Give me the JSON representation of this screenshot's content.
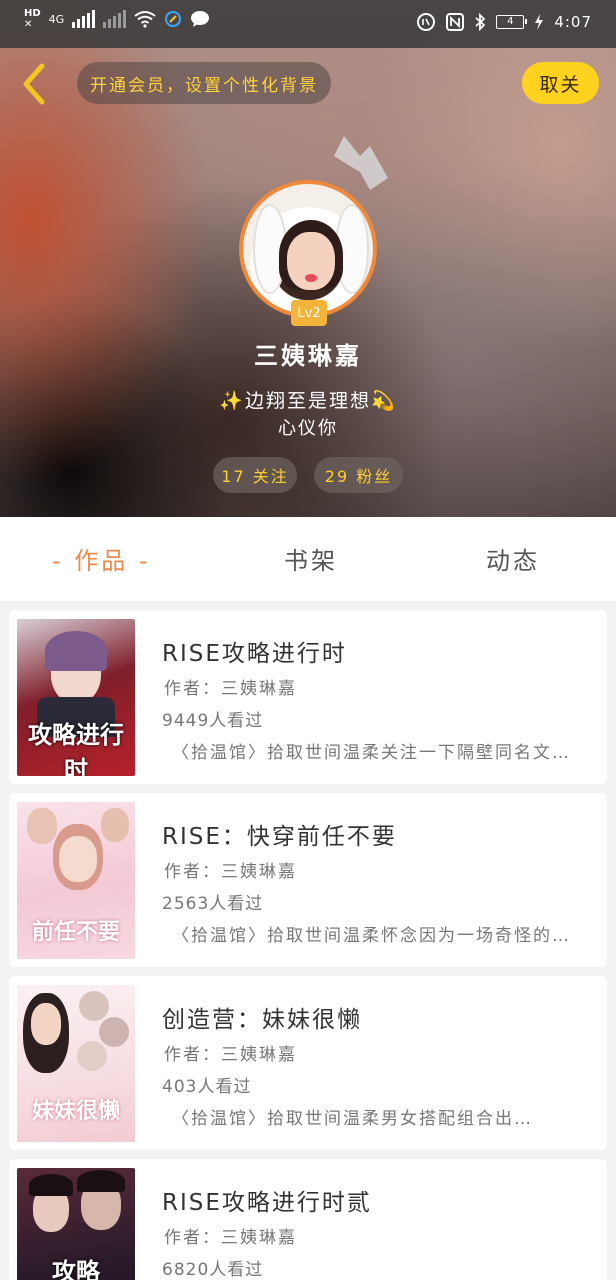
{
  "status_bar": {
    "hd": "HD",
    "network": "4G",
    "battery": "4",
    "time": "4:07"
  },
  "header": {
    "back_icon": "chevron-left-icon",
    "vip_prompt": "开通会员，设置个性化背景",
    "unfollow_label": "取关",
    "level": "Lv2",
    "username": "三姨琳嘉",
    "signature_line1": "✨边翔至是理想💫",
    "signature_line2": "心仪你",
    "follow_count": "17 关注",
    "fans_count": "29 粉丝"
  },
  "tabs": [
    {
      "label": "- 作品 -",
      "active": true
    },
    {
      "label": "书架",
      "active": false
    },
    {
      "label": "动态",
      "active": false
    }
  ],
  "books": [
    {
      "title": "RISE攻略进行时",
      "author": "作者：三姨琳嘉",
      "views": "9449人看过",
      "intro": "〈拾温馆〉拾取世间温柔关注一下隔壁同名文…",
      "cover_text": "攻略进行时",
      "cover_color": "#b7202a"
    },
    {
      "title": "RISE：快穿前任不要",
      "author": "作者：三姨琳嘉",
      "views": "2563人看过",
      "intro": "〈拾温馆〉拾取世间温柔怀念因为一场奇怪的…",
      "cover_text": "前任不要",
      "cover_color": "#f3c6d2"
    },
    {
      "title": "创造营：妹妹很懒",
      "author": "作者：三姨琳嘉",
      "views": "403人看过",
      "intro": "〈拾温馆〉拾取世间温柔男女搭配组合出…",
      "cover_text": "妹妹很懒",
      "cover_color": "#f6dde2"
    },
    {
      "title": "RISE攻略进行时贰",
      "author": "作者：三姨琳嘉",
      "views": "6820人看过",
      "intro": "",
      "cover_text": "攻略",
      "cover_color": "#2b1b2a"
    }
  ]
}
